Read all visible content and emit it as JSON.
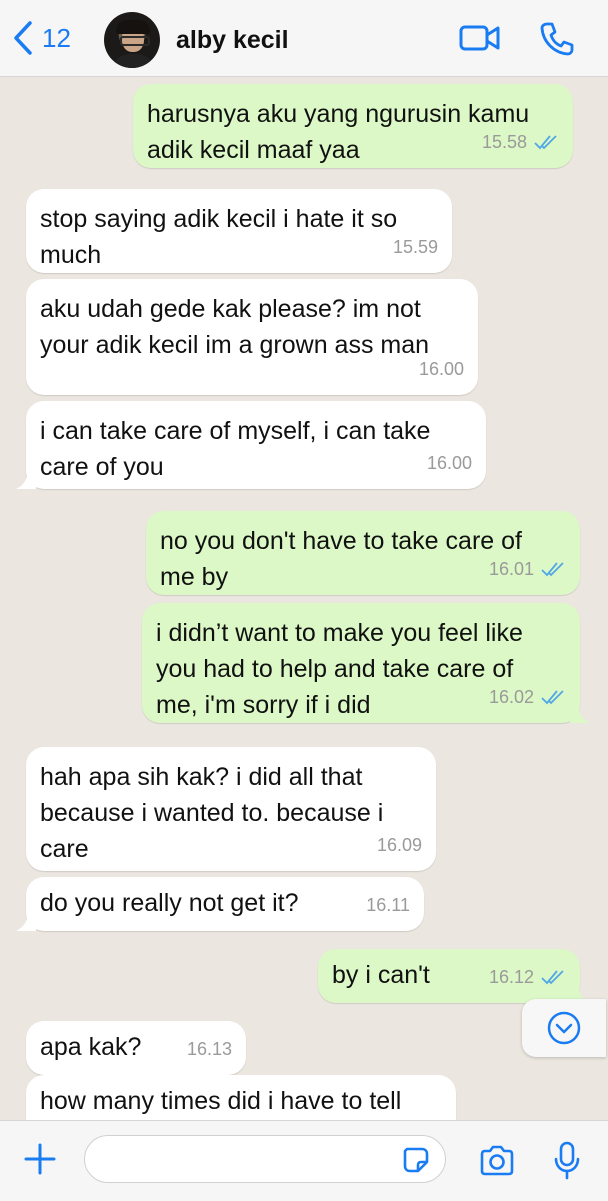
{
  "header": {
    "back_count": "12",
    "contact_name": "alby kecil"
  },
  "messages": [
    {
      "dir": "out",
      "text": "harusnya aku yang ngurusin kamu\nadik kecil maaf yaa",
      "time": "15.58",
      "read": true
    },
    {
      "dir": "in",
      "text": "stop saying adik kecil i hate it so\nmuch",
      "time": "15.59"
    },
    {
      "dir": "in",
      "text": "aku udah gede kak please? im not\nyour adik kecil im a grown ass man",
      "time": "16.00"
    },
    {
      "dir": "in",
      "text": "i can take care of myself, i can take\ncare of you",
      "time": "16.00"
    },
    {
      "dir": "out",
      "text": "no you don't have to take care of\nme by",
      "time": "16.01",
      "read": true
    },
    {
      "dir": "out",
      "text": "i didn’t want to make you feel like\nyou had to help and take care of\nme, i'm sorry if i did",
      "time": "16.02",
      "read": true
    },
    {
      "dir": "in",
      "text": "hah apa sih kak? i did all that\nbecause i wanted to. because i\ncare",
      "time": "16.09"
    },
    {
      "dir": "in",
      "text": "do you really not get it?",
      "time": "16.11"
    },
    {
      "dir": "out",
      "text": "by i can't",
      "time": "16.12",
      "read": true
    },
    {
      "dir": "in",
      "text": "apa kak?",
      "time": "16.13"
    },
    {
      "dir": "in",
      "text": "how many times did i have to tell",
      "time": ""
    }
  ],
  "input": {
    "placeholder": ""
  },
  "colors": {
    "accent": "#1a7cf2",
    "outgoing_bubble": "#dcf8c6",
    "incoming_bubble": "#ffffff",
    "chat_background": "#ebe6df",
    "read_ticks": "#4fa8e6"
  },
  "icons": [
    "chevron-left-icon",
    "video-camera-icon",
    "phone-icon",
    "chevron-down-icon",
    "plus-icon",
    "sticker-icon",
    "camera-icon",
    "microphone-icon",
    "double-check-icon"
  ]
}
